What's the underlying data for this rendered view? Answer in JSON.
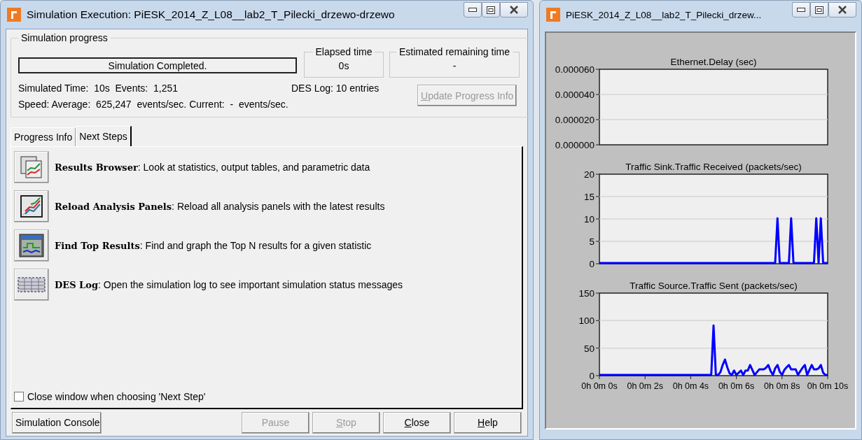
{
  "main_window": {
    "title": "Simulation Execution: PiESK_2014_Z_L08__lab2_T_Pilecki_drzewo-drzewo",
    "progress": {
      "title": "Simulation progress",
      "status": "Simulation Completed.",
      "elapsed": {
        "label": "Elapsed time",
        "value": "0s"
      },
      "remaining": {
        "label": "Estimated remaining time",
        "value": "-"
      },
      "lines": [
        "Simulated Time:  10s  Events:  1,251",
        "Speed: Average:  625,247  events/sec. Current:  -  events/sec."
      ],
      "des_log": "DES Log: 10 entries",
      "update_button": {
        "label": "Update Progress Info",
        "disabled": true,
        "mnemonic": true
      }
    },
    "tabs": [
      {
        "label": "Progress Info",
        "selected": false
      },
      {
        "label": "Next Steps",
        "selected": true
      }
    ],
    "next_steps": [
      {
        "kind": "results_browser",
        "text": "**Results Browser**: Look at statistics, output tables, and parametric data"
      },
      {
        "kind": "reload_panels",
        "text": "**Reload Analysis Panels**: Reload all analysis panels with the latest results"
      },
      {
        "kind": "top_results",
        "text": "**Find Top Results**: Find and graph the Top N results for a given statistic"
      },
      {
        "kind": "des_log",
        "text": "**DES Log**: Open the simulation log to see important simulation status messages"
      }
    ],
    "close_option": {
      "label": "Close window when choosing 'Next Step'",
      "checked": false
    },
    "buttons": [
      {
        "label": "Simulation Console",
        "disabled": false,
        "mnemonic": false
      },
      {
        "label": "Pause",
        "disabled": true,
        "mnemonic": false
      },
      {
        "label": "Stop",
        "disabled": true,
        "mnemonic": true
      },
      {
        "label": "Close",
        "disabled": false,
        "mnemonic": true
      },
      {
        "label": "Help",
        "disabled": false,
        "mnemonic": true
      }
    ]
  },
  "graph_window": {
    "title": "PiESK_2014_Z_L08__lab2_T_Pilecki_drzew...",
    "charts": [
      {
        "title": "Ethernet.Delay (sec)",
        "axis_labels": [
          "0.000060",
          "0.000040",
          "0.000020",
          "0.000000"
        ]
      },
      {
        "chart_data": {
          "type": "line",
          "title": "Traffic Sink.Traffic Received (packets/sec)",
          "grid": true,
          "ylim": [
            0,
            20
          ],
          "yticks": [
            0,
            5,
            10,
            15,
            20
          ],
          "categories": [
            null,
            null,
            null,
            null,
            null,
            null,
            null,
            null,
            null,
            null,
            null,
            null,
            null,
            null,
            null,
            null,
            null,
            null,
            null,
            null,
            null,
            null,
            null,
            null,
            null,
            null,
            null,
            null,
            null,
            null,
            null,
            null,
            null,
            null,
            null,
            null,
            null,
            null,
            null,
            null,
            null,
            null,
            null,
            null,
            null,
            null,
            null,
            null,
            null,
            null,
            null,
            null,
            null,
            null,
            null,
            null,
            null,
            null,
            null,
            null,
            null,
            null,
            null,
            null,
            null,
            null,
            null,
            null,
            null,
            null,
            null,
            null,
            null,
            null,
            null,
            null,
            null,
            null,
            null,
            null,
            null,
            null,
            null,
            null,
            null,
            null,
            null,
            null,
            null,
            null,
            null,
            null,
            null,
            null,
            null,
            null,
            null,
            null,
            null,
            null,
            null
          ],
          "series": [
            {
              "color": "#0000ff",
              "values": [
                0,
                0,
                0,
                0,
                0,
                0,
                0,
                0,
                0,
                0,
                0,
                0,
                0,
                0,
                0,
                0,
                0,
                0,
                0,
                0,
                0,
                0,
                0,
                0,
                0,
                0,
                0,
                0,
                0,
                0,
                0,
                0,
                0,
                0,
                0,
                0,
                0,
                0,
                0,
                0,
                0,
                0,
                0,
                0,
                0,
                0,
                0,
                0,
                0,
                0,
                0,
                0,
                0,
                0,
                0,
                0,
                0,
                0,
                0,
                0,
                0,
                0,
                0,
                0,
                0,
                0,
                0,
                0,
                0,
                0,
                0,
                0,
                0,
                0,
                0,
                0,
                0,
                0,
                10,
                0,
                0,
                0,
                0,
                0,
                10,
                0,
                0,
                0,
                0,
                0,
                0,
                0,
                0,
                0,
                0,
                10,
                0,
                10,
                0,
                0,
                0
              ]
            }
          ]
        }
      },
      {
        "chart_data": {
          "type": "line",
          "title": "Traffic Source.Traffic Sent (packets/sec)",
          "grid": true,
          "ylim": [
            0,
            150
          ],
          "yticks": [
            0,
            50,
            100,
            150
          ],
          "categories": [
            "0h 0m 0s",
            null,
            null,
            null,
            null,
            null,
            null,
            null,
            null,
            null,
            null,
            null,
            null,
            null,
            null,
            null,
            null,
            null,
            null,
            null,
            "0h 0m 2s",
            null,
            null,
            null,
            null,
            null,
            null,
            null,
            null,
            null,
            null,
            null,
            null,
            null,
            null,
            null,
            null,
            null,
            null,
            null,
            "0h 0m 4s",
            null,
            null,
            null,
            null,
            null,
            null,
            null,
            null,
            null,
            null,
            null,
            null,
            null,
            null,
            null,
            null,
            null,
            null,
            null,
            "0h 0m 6s",
            null,
            null,
            null,
            null,
            null,
            null,
            null,
            null,
            null,
            null,
            null,
            null,
            null,
            null,
            null,
            null,
            null,
            null,
            null,
            "0h 0m 8s",
            null,
            null,
            null,
            null,
            null,
            null,
            null,
            null,
            null,
            null,
            null,
            null,
            null,
            null,
            null,
            null,
            null,
            null,
            null,
            "0h 0m 10s"
          ],
          "series": [
            {
              "color": "#0000ff",
              "values": [
                0,
                0,
                0,
                0,
                0,
                0,
                0,
                0,
                0,
                0,
                0,
                0,
                0,
                0,
                0,
                0,
                0,
                0,
                0,
                0,
                0,
                0,
                0,
                0,
                0,
                0,
                0,
                0,
                0,
                0,
                0,
                0,
                0,
                0,
                0,
                0,
                0,
                0,
                0,
                0,
                0,
                0,
                0,
                0,
                0,
                0,
                0,
                0,
                0,
                0,
                90,
                0,
                0,
                5,
                18,
                28,
                14,
                3,
                0,
                8,
                0,
                4,
                8,
                0,
                8,
                8,
                18,
                9,
                0,
                5,
                10,
                10,
                10,
                13,
                18,
                7,
                0,
                12,
                18,
                6,
                0,
                9,
                14,
                18,
                10,
                10,
                10,
                0,
                7,
                13,
                18,
                0,
                9,
                18,
                10,
                10,
                12,
                18,
                4,
                0,
                0
              ]
            }
          ]
        }
      }
    ]
  }
}
